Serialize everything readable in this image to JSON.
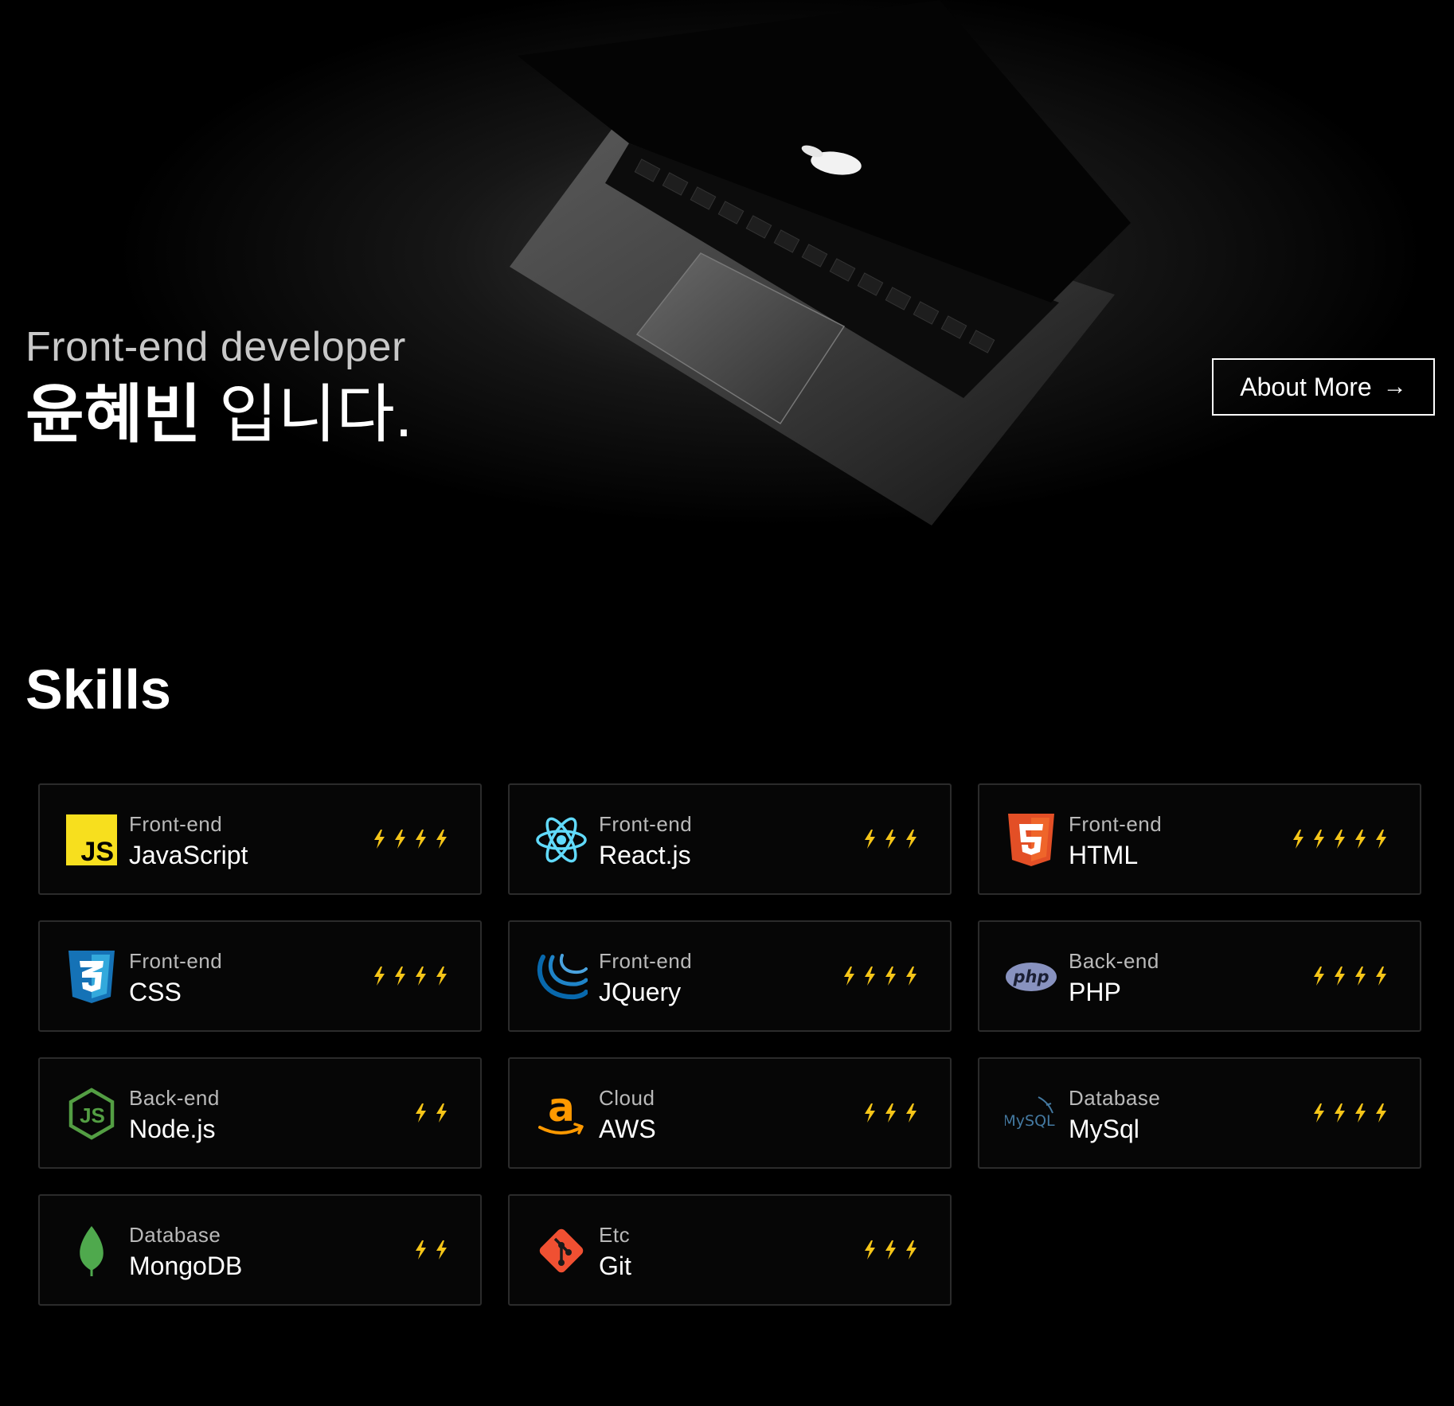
{
  "hero": {
    "subtitle": "Front-end developer",
    "name": "윤혜빈",
    "title_rest": " 입니다.",
    "about_button": "About More",
    "about_arrow": "→"
  },
  "skills": {
    "heading": "Skills",
    "items": [
      {
        "category": "Front-end",
        "name": "JavaScript",
        "rating": 4,
        "icon": "javascript-icon"
      },
      {
        "category": "Front-end",
        "name": "React.js",
        "rating": 3,
        "icon": "react-icon"
      },
      {
        "category": "Front-end",
        "name": "HTML",
        "rating": 5,
        "icon": "html5-icon"
      },
      {
        "category": "Front-end",
        "name": "CSS",
        "rating": 4,
        "icon": "css3-icon"
      },
      {
        "category": "Front-end",
        "name": "JQuery",
        "rating": 4,
        "icon": "jquery-icon"
      },
      {
        "category": "Back-end",
        "name": "PHP",
        "rating": 4,
        "icon": "php-icon"
      },
      {
        "category": "Back-end",
        "name": "Node.js",
        "rating": 2,
        "icon": "nodejs-icon"
      },
      {
        "category": "Cloud",
        "name": "AWS",
        "rating": 3,
        "icon": "aws-icon"
      },
      {
        "category": "Database",
        "name": "MySql",
        "rating": 4,
        "icon": "mysql-icon"
      },
      {
        "category": "Database",
        "name": "MongoDB",
        "rating": 2,
        "icon": "mongodb-icon"
      },
      {
        "category": "Etc",
        "name": "Git",
        "rating": 3,
        "icon": "git-icon"
      }
    ]
  },
  "colors": {
    "background": "#000000",
    "bolt": "#f5c518",
    "card_border": "#2b2b2b"
  }
}
